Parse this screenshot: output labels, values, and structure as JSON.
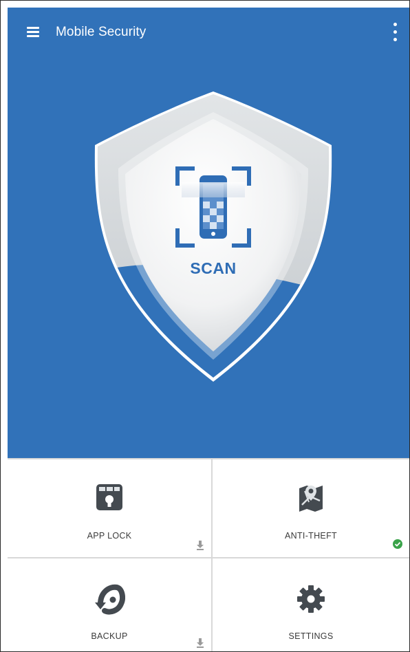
{
  "appbar": {
    "title": "Mobile Security",
    "menu_icon": "hamburger-menu-icon",
    "overflow_icon": "more-vert-icon"
  },
  "hero": {
    "scan_label": "SCAN",
    "icon": "phone-scan-icon"
  },
  "tiles": [
    {
      "label": "APP LOCK",
      "icon": "app-lock-icon",
      "status": "download-icon"
    },
    {
      "label": "ANTI-THEFT",
      "icon": "map-location-icon",
      "status": "check-icon"
    },
    {
      "label": "BACKUP",
      "icon": "backup-restore-icon",
      "status": "download-icon"
    },
    {
      "label": "SETTINGS",
      "icon": "gear-icon",
      "status": ""
    }
  ],
  "colors": {
    "primary": "#3172b9",
    "status_ok": "#3aa34a",
    "icon_dark": "#444a50"
  }
}
